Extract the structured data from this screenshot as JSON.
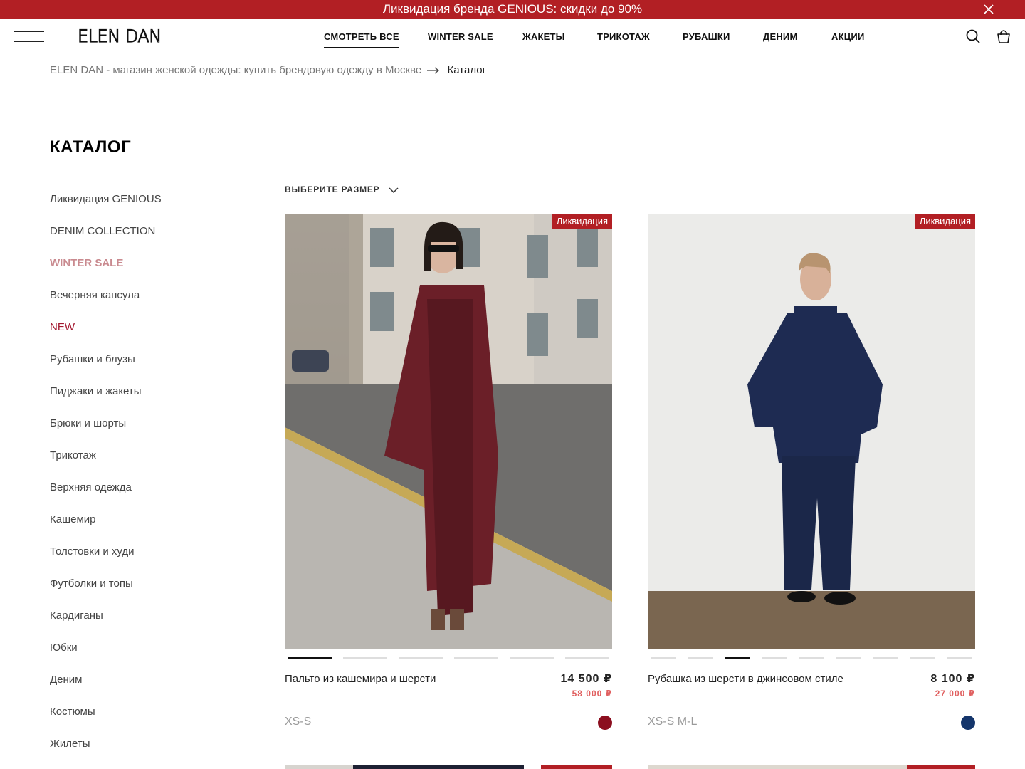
{
  "promo": {
    "text": "Ликвидация бренда GENIOUS: скидки до 90%"
  },
  "header": {
    "logo": "ELEN DAN",
    "nav": [
      {
        "label": "СМОТРЕТЬ ВСЕ",
        "active": true
      },
      {
        "label": "WINTER SALE"
      },
      {
        "label": "ЖАКЕТЫ"
      },
      {
        "label": "ТРИКОТАЖ"
      },
      {
        "label": "РУБАШКИ"
      },
      {
        "label": "ДЕНИМ"
      },
      {
        "label": "АКЦИИ"
      }
    ],
    "icons": [
      "menu-icon",
      "search-icon",
      "bag-icon",
      "close-icon"
    ]
  },
  "breadcrumb": {
    "home": "ELEN DAN - магазин женской одежды: купить брендовую одежду в Москве",
    "current": "Каталог"
  },
  "page": {
    "title": "КАТАЛОГ",
    "size_filter": "ВЫБЕРИТЕ РАЗМЕР"
  },
  "sidebar": {
    "items": [
      {
        "label": "Ликвидация GENIOUS"
      },
      {
        "label": "DENIM COLLECTION"
      },
      {
        "label": "WINTER SALE"
      },
      {
        "label": "Вечерняя капсула"
      },
      {
        "label": "NEW"
      },
      {
        "label": "Рубашки и блузы"
      },
      {
        "label": "Пиджаки и жакеты"
      },
      {
        "label": "Брюки и шорты"
      },
      {
        "label": "Трикотаж"
      },
      {
        "label": "Верхняя одежда"
      },
      {
        "label": "Кашемир"
      },
      {
        "label": "Толстовки и худи"
      },
      {
        "label": "Футболки и топы"
      },
      {
        "label": "Кардиганы"
      },
      {
        "label": "Юбки"
      },
      {
        "label": "Деним"
      },
      {
        "label": "Костюмы"
      },
      {
        "label": "Жилеты"
      }
    ],
    "colors": {
      "winter_sale": "#c98a8f",
      "new": "#a3182f"
    }
  },
  "products": [
    {
      "badge": "Ликвидация",
      "name": "Пальто из кашемира и шерсти",
      "price": "14 500 ₽",
      "old_price": "58 000 ₽",
      "sizes": "XS-S",
      "swatch_color": "#8c0f1f",
      "photo_slides": 6,
      "active_slide": 1
    },
    {
      "badge": "Ликвидация",
      "name": "Рубашка из шерсти в джинсовом стиле",
      "price": "8 100 ₽",
      "old_price": "27 000 ₽",
      "sizes": "XS-S M-L",
      "swatch_color": "#14356b",
      "photo_slides": 9,
      "active_slide": 3
    }
  ],
  "colors": {
    "accent": "#b21f24",
    "old_price": "#e06060"
  }
}
